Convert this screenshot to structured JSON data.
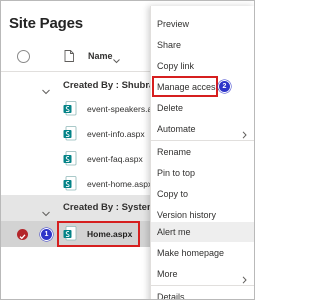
{
  "page": {
    "title": "Site Pages"
  },
  "header": {
    "name_col": "Name"
  },
  "groups": [
    {
      "label": "Created By : Shubrato",
      "files": [
        "event-speakers.aspx",
        "event-info.aspx",
        "event-faq.aspx",
        "event-home.aspx"
      ]
    },
    {
      "label": "Created By : System Account",
      "files": [
        "Home.aspx"
      ]
    }
  ],
  "annotations": {
    "badge_1": "1",
    "badge_2": "2"
  },
  "menu": {
    "items": [
      "Preview",
      "Share",
      "Copy link",
      "Manage access",
      "Delete",
      "Automate",
      "Rename",
      "Pin to top",
      "Copy to",
      "Version history",
      "Alert me",
      "Make homepage",
      "More",
      "Details"
    ]
  },
  "colors": {
    "annotation_red": "#d61f1f",
    "badge_blue": "#2e34c9",
    "aspx_teal": "#038387",
    "selected_check": "#b4262a"
  },
  "icons": [
    "file-icon",
    "sitepage-icon",
    "chevron-down-icon",
    "chevron-right-icon",
    "checkmark-icon"
  ]
}
